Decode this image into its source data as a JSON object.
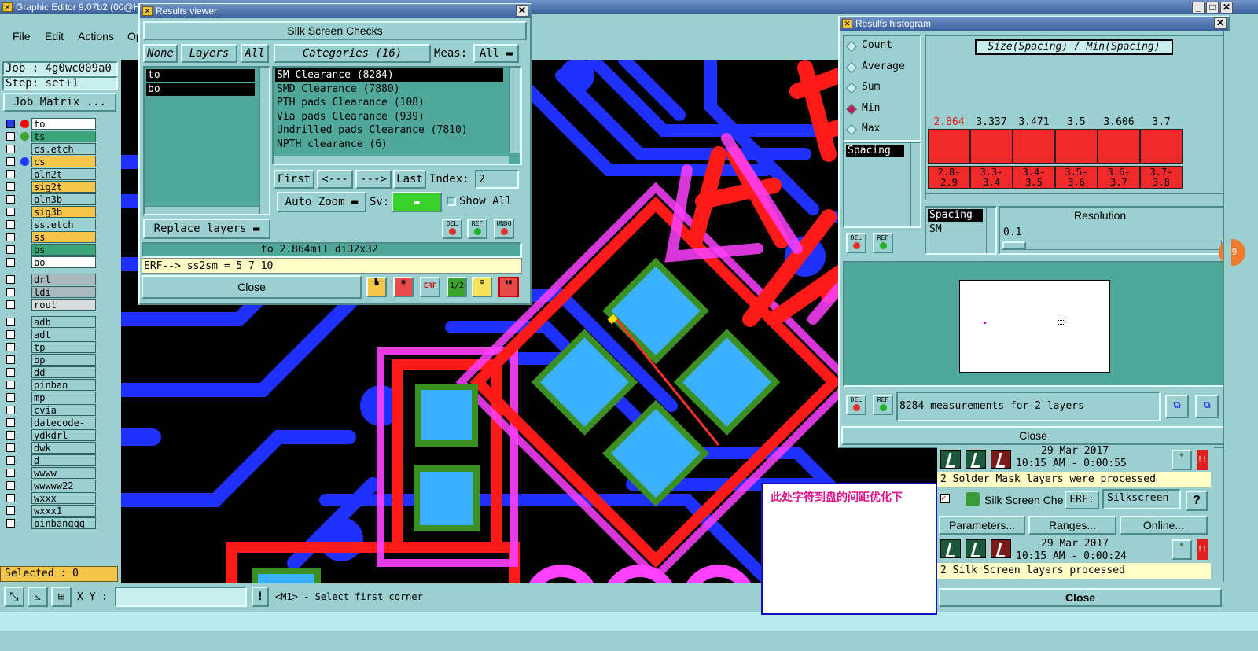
{
  "main_window": {
    "title": "Graphic Editor 9.07b2 (00@H"
  },
  "menu": [
    "File",
    "Edit",
    "Actions",
    "Op"
  ],
  "job": {
    "job_label": "Job : 4g0wc009a0",
    "step_label": "Step: set+1",
    "matrix_button": "Job Matrix ..."
  },
  "layers": [
    {
      "name": "to",
      "bg": "#ffffff",
      "dot": "#ff0000"
    },
    {
      "name": "ts",
      "bg": "#3aa57a",
      "dot": "#3aa52a"
    },
    {
      "name": "cs.etch",
      "bg": "#9ccfcf",
      "dot": ""
    },
    {
      "name": "cs",
      "bg": "#f5c64a",
      "dot": "#1e3cff"
    },
    {
      "name": "pln2t",
      "bg": "#9ccfcf",
      "dot": ""
    },
    {
      "name": "sig2t",
      "bg": "#f5c64a",
      "dot": ""
    },
    {
      "name": "pln3b",
      "bg": "#9ccfcf",
      "dot": ""
    },
    {
      "name": "sig3b",
      "bg": "#f5c64a",
      "dot": ""
    },
    {
      "name": "ss.etch",
      "bg": "#9ccfcf",
      "dot": ""
    },
    {
      "name": "ss",
      "bg": "#f5c64a",
      "dot": ""
    },
    {
      "name": "bs",
      "bg": "#3aa57a",
      "dot": ""
    },
    {
      "name": "bo",
      "bg": "#ffffff",
      "dot": ""
    },
    {
      "name": "drl",
      "bg": "#a9b7bf",
      "dot": ""
    },
    {
      "name": "ldi",
      "bg": "#a9b7bf",
      "dot": ""
    },
    {
      "name": "rout",
      "bg": "#d8dcdc",
      "dot": ""
    },
    {
      "name": "adb",
      "bg": "#9ccfcf",
      "dot": ""
    },
    {
      "name": "adt",
      "bg": "#9ccfcf",
      "dot": ""
    },
    {
      "name": "tp",
      "bg": "#9ccfcf",
      "dot": ""
    },
    {
      "name": "bp",
      "bg": "#9ccfcf",
      "dot": ""
    },
    {
      "name": "dd",
      "bg": "#9ccfcf",
      "dot": ""
    },
    {
      "name": "pinban",
      "bg": "#9ccfcf",
      "dot": ""
    },
    {
      "name": "mp",
      "bg": "#9ccfcf",
      "dot": ""
    },
    {
      "name": "cvia",
      "bg": "#9ccfcf",
      "dot": ""
    },
    {
      "name": "datecode-pte",
      "bg": "#9ccfcf",
      "dot": ""
    },
    {
      "name": "ydkdrl",
      "bg": "#9ccfcf",
      "dot": ""
    },
    {
      "name": "dwk",
      "bg": "#9ccfcf",
      "dot": ""
    },
    {
      "name": "d",
      "bg": "#9ccfcf",
      "dot": ""
    },
    {
      "name": "wwww",
      "bg": "#9ccfcf",
      "dot": ""
    },
    {
      "name": "wwwww22",
      "bg": "#9ccfcf",
      "dot": ""
    },
    {
      "name": "wxxx",
      "bg": "#9ccfcf",
      "dot": ""
    },
    {
      "name": "wxxx1",
      "bg": "#9ccfcf",
      "dot": ""
    },
    {
      "name": "pinbanqqq",
      "bg": "#9ccfcf",
      "dot": ""
    }
  ],
  "selected_label": "Selected : 0",
  "bottom_bar": {
    "xy_label": "X Y :",
    "xy_value": "",
    "status": "<M1> - Select first corner"
  },
  "results_viewer": {
    "title": "Results viewer",
    "heading": "Silk Screen Checks",
    "none_btn": "None",
    "layers_btn": "Layers",
    "all_btn": "All",
    "layers_list": [
      "to",
      "bo"
    ],
    "categories_btn": "Categories (16)",
    "meas_label": "Meas:",
    "meas_value": "All",
    "categories": [
      "SM Clearance (8284)",
      "SMD Clearance (7880)",
      "PTH pads Clearance (108)",
      "Via pads Clearance (939)",
      "Undrilled pads Clearance (7810)",
      "NPTH clearance (6)"
    ],
    "first_btn": "First",
    "prev_btn": "<---",
    "next_btn": "--->",
    "last_btn": "Last",
    "index_label": "Index:",
    "index_value": "2",
    "auto_zoom": "Auto Zoom",
    "sv_label": "Sv:",
    "show_all": "Show All",
    "replace_layers": "Replace layers",
    "del": "DEL",
    "ref": "REF",
    "undo": "UNDO",
    "status_line": "to 2.864mil  di32x32",
    "erf_line": "ERF--> ss2sm = 5 7 10",
    "close": "Close",
    "icon_erf": "ERF",
    "icon_12": "1/2"
  },
  "histogram": {
    "title": "Results histogram",
    "options": [
      {
        "label": "Count",
        "checked": false
      },
      {
        "label": "Average",
        "checked": false
      },
      {
        "label": "Sum",
        "checked": false
      },
      {
        "label": "Min",
        "checked": true
      },
      {
        "label": "Max",
        "checked": false
      }
    ],
    "chart_title": "Size(Spacing) / Min(Spacing)",
    "list_item": "Spacing",
    "bars": [
      {
        "value": "2.864",
        "bin": [
          "2.8-",
          "2.9"
        ]
      },
      {
        "value": "3.337",
        "bin": [
          "3.3-",
          "3.4"
        ]
      },
      {
        "value": "3.471",
        "bin": [
          "3.4-",
          "3.5"
        ]
      },
      {
        "value": "3.5",
        "bin": [
          "3.5-",
          "3.6"
        ]
      },
      {
        "value": "3.606",
        "bin": [
          "3.6-",
          "3.7"
        ]
      },
      {
        "value": "3.7",
        "bin": [
          "3.7-",
          "3.8"
        ]
      }
    ],
    "list2": [
      "Spacing",
      "SM"
    ],
    "resolution_label": "Resolution",
    "resolution_value": "0.1",
    "measurements": "8284 measurements for 2 layers",
    "close": "Close",
    "del": "DEL",
    "ref": "REF"
  },
  "side_badge": "79",
  "checklist": {
    "date1": "29 Mar 2017",
    "time1": "10:15 AM - 0:00:55",
    "msg1": "2 Solder Mask layers were processed",
    "silk_label": "Silk Screen Che",
    "erf_btn": "ERF:",
    "erf_value": "Silkscreen",
    "help": "?",
    "parameters": "Parameters...",
    "ranges": "Ranges...",
    "online": "Online...",
    "date2": "29 Mar 2017",
    "time2": "10:15 AM - 0:00:24",
    "msg2": "2 Silk Screen layers processed",
    "close": "Close",
    "alert": "!!"
  },
  "annotation": "此处字符到盘的间距优化下"
}
